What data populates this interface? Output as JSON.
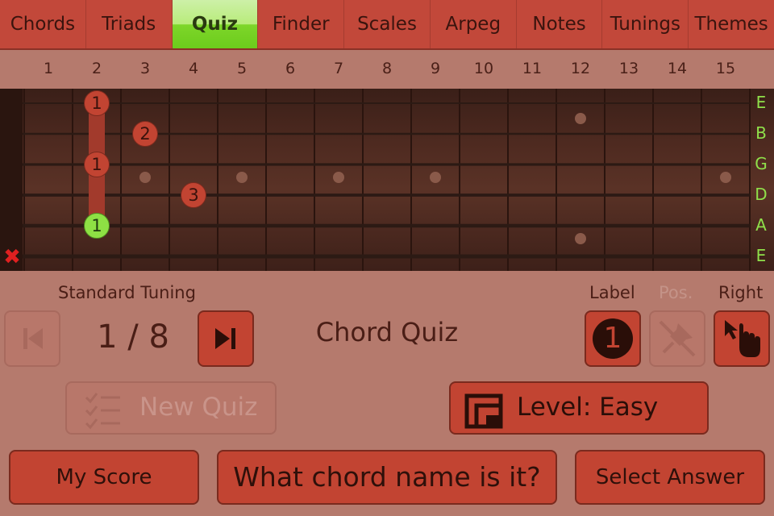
{
  "nav": {
    "tabs": [
      {
        "label": "Chords",
        "active": false
      },
      {
        "label": "Triads",
        "active": false
      },
      {
        "label": "Quiz",
        "active": true
      },
      {
        "label": "Finder",
        "active": false
      },
      {
        "label": "Scales",
        "active": false
      },
      {
        "label": "Arpeg",
        "active": false
      },
      {
        "label": "Notes",
        "active": false
      },
      {
        "label": "Tunings",
        "active": false
      },
      {
        "label": "Themes",
        "active": false
      }
    ]
  },
  "fretboard": {
    "fret_numbers": [
      "1",
      "2",
      "3",
      "4",
      "5",
      "6",
      "7",
      "8",
      "9",
      "10",
      "11",
      "12",
      "13",
      "14",
      "15"
    ],
    "strings": [
      "E",
      "B",
      "G",
      "D",
      "A",
      "E"
    ],
    "notes": [
      {
        "string": 0,
        "fret": 2,
        "label": "1",
        "root": false
      },
      {
        "string": 1,
        "fret": 3,
        "label": "2",
        "root": false
      },
      {
        "string": 2,
        "fret": 2,
        "label": "1",
        "root": false
      },
      {
        "string": 3,
        "fret": 4,
        "label": "3",
        "root": false
      },
      {
        "string": 4,
        "fret": 2,
        "label": "1",
        "root": true
      }
    ],
    "muted_string": 5
  },
  "controls": {
    "tuning_label": "Standard Tuning",
    "counter": "1 / 8",
    "title": "Chord Quiz",
    "label_caption": "Label",
    "pos_caption": "Pos.",
    "right_caption": "Right",
    "label_button_value": "1",
    "new_quiz_label": "New Quiz",
    "level_label": "Level: Easy",
    "my_score_label": "My Score",
    "question_label": "What chord name is it?",
    "select_answer_label": "Select Answer"
  },
  "colors": {
    "accent": "#c24432",
    "active_tab": "#7ed62a",
    "root_note": "#8ee044",
    "background": "#b57a6d"
  }
}
